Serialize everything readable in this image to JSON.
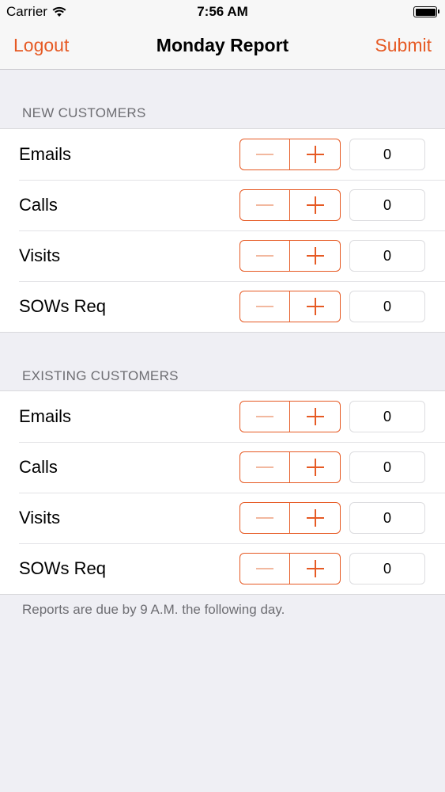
{
  "status_bar": {
    "carrier": "Carrier",
    "time": "7:56 AM"
  },
  "nav": {
    "left": "Logout",
    "title": "Monday Report",
    "right": "Submit"
  },
  "sections": [
    {
      "header": "NEW CUSTOMERS",
      "rows": [
        {
          "label": "Emails",
          "value": "0"
        },
        {
          "label": "Calls",
          "value": "0"
        },
        {
          "label": "Visits",
          "value": "0"
        },
        {
          "label": "SOWs Req",
          "value": "0"
        }
      ]
    },
    {
      "header": "EXISTING CUSTOMERS",
      "rows": [
        {
          "label": "Emails",
          "value": "0"
        },
        {
          "label": "Calls",
          "value": "0"
        },
        {
          "label": "Visits",
          "value": "0"
        },
        {
          "label": "SOWs Req",
          "value": "0"
        }
      ]
    }
  ],
  "footer": "Reports are due by 9 A.M. the following day.",
  "colors": {
    "accent": "#e65a24",
    "background": "#efeff4"
  }
}
